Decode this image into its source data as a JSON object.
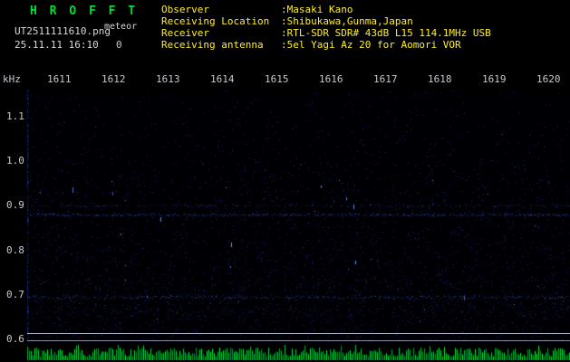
{
  "header": {
    "app_title": "H R O F F T",
    "filename": "UT2511111610.png",
    "station": "meteor",
    "datetime": "25.11.11 16:10",
    "count": "0",
    "info_rows": [
      {
        "label": "Observer",
        "value": ":Masaki Kano"
      },
      {
        "label": "Receiving Location",
        "value": ":Shibukawa,Gunma,Japan"
      },
      {
        "label": "Receiver",
        "value": ":RTL-SDR SDR# 43dB L15 114.1MHz USB"
      },
      {
        "label": "Receiving antenna",
        "value": ":5el Yagi Az 20 for Aomori VOR"
      }
    ]
  },
  "chart_data": {
    "type": "heatmap",
    "title": "HROFFT radio meteor spectrogram, 16:10-16:20 UT",
    "x_ticks": [
      "1611",
      "1612",
      "1613",
      "1614",
      "1615",
      "1616",
      "1617",
      "1618",
      "1619",
      "1620"
    ],
    "x_range": [
      "16:10",
      "16:20"
    ],
    "y_unit": "kHz",
    "y_ticks": [
      "1.1",
      "1.0",
      "0.9",
      "0.8",
      "0.7",
      "0.6"
    ],
    "y_range_khz": [
      0.6,
      1.16
    ],
    "grid": false,
    "legend_position": "none",
    "content_description": "sparse blue noise speckle over black; faint continuous horizontal noise bands near 0.88-0.90 kHz and 0.66-0.70 kHz; two light gray baseline lines near 0.60-0.61 kHz; green signal-level tick strip along the bottom",
    "noise_bands": [
      {
        "khz": 0.88,
        "strength": 0.8,
        "spread": 1.2
      },
      {
        "khz": 0.9,
        "strength": 0.4,
        "spread": 1.0
      },
      {
        "khz": 0.695,
        "strength": 0.75,
        "spread": 1.8
      },
      {
        "khz": 0.66,
        "strength": 0.3,
        "spread": 5.0
      },
      {
        "khz": 0.73,
        "strength": 0.2,
        "spread": 4.0
      }
    ],
    "baseline_lines_khz": [
      0.61,
      0.6
    ]
  },
  "colors": {
    "title_green": "#00dd33",
    "header_yellow": "#ffee22",
    "axis_text": "#c8c8d0",
    "plot_background": "#000004",
    "noise_blue": "#2a46d2",
    "comb_green": "#00cc44",
    "baseline_top": "#aab0c0",
    "baseline_bottom": "#8890a8"
  }
}
